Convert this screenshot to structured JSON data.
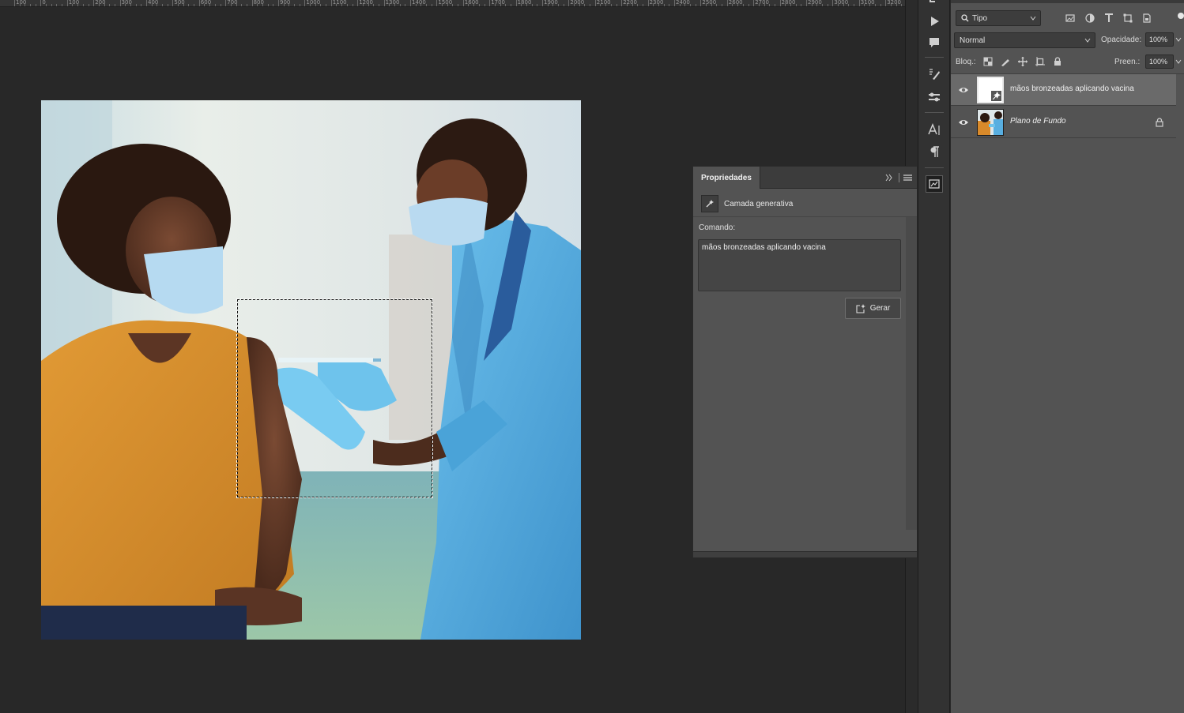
{
  "ruler": {
    "labels": [
      "100",
      "0",
      "100",
      "200",
      "300",
      "400",
      "500",
      "600",
      "700",
      "800",
      "900",
      "1000",
      "1100",
      "1200",
      "1300",
      "1400",
      "1500",
      "1600",
      "1700",
      "1800",
      "1900",
      "2000",
      "2100",
      "2200",
      "2300",
      "2400",
      "2500",
      "2600",
      "2700",
      "2800",
      "2900",
      "3000",
      "3100",
      "3200"
    ]
  },
  "toolstrip": {
    "icons": [
      "play-icon",
      "comment-icon",
      "brush-settings-icon",
      "adjustments-icon",
      "character-icon",
      "paragraph-icon",
      "properties-panel-icon"
    ]
  },
  "layers_panel": {
    "filter": {
      "label": "Tipo",
      "icon": "search-icon"
    },
    "filter_icons": [
      "image-filter-icon",
      "adjustment-filter-icon",
      "type-filter-icon",
      "shape-filter-icon",
      "smartobject-filter-icon"
    ],
    "blend_mode": "Normal",
    "opacity_label": "Opacidade:",
    "opacity_value": "100%",
    "lock_label": "Bloq.:",
    "lock_icons": [
      "lock-transparency-icon",
      "lock-pixels-icon",
      "lock-position-icon",
      "lock-artboard-icon",
      "lock-all-icon"
    ],
    "fill_label": "Preen.:",
    "fill_value": "100%",
    "layers": [
      {
        "name": "mãos bronzeadas aplicando vacina",
        "visible": true,
        "active": true,
        "type": "generative"
      },
      {
        "name": "Plano de Fundo",
        "visible": true,
        "active": false,
        "type": "background",
        "locked": true
      }
    ]
  },
  "properties_panel": {
    "tab_label": "Propriedades",
    "layer_kind": "Camada generativa",
    "command_label": "Comando:",
    "command_text": "mãos bronzeadas aplicando vacina",
    "generate_button": "Gerar"
  },
  "colors": {
    "app_bg": "#282828",
    "panel_bg": "#535353",
    "active_layer": "#6a6a6a",
    "shirt_orange": "#d98a2a",
    "scrubs_blue": "#58aee0",
    "glove_blue": "#6ec3ec"
  }
}
